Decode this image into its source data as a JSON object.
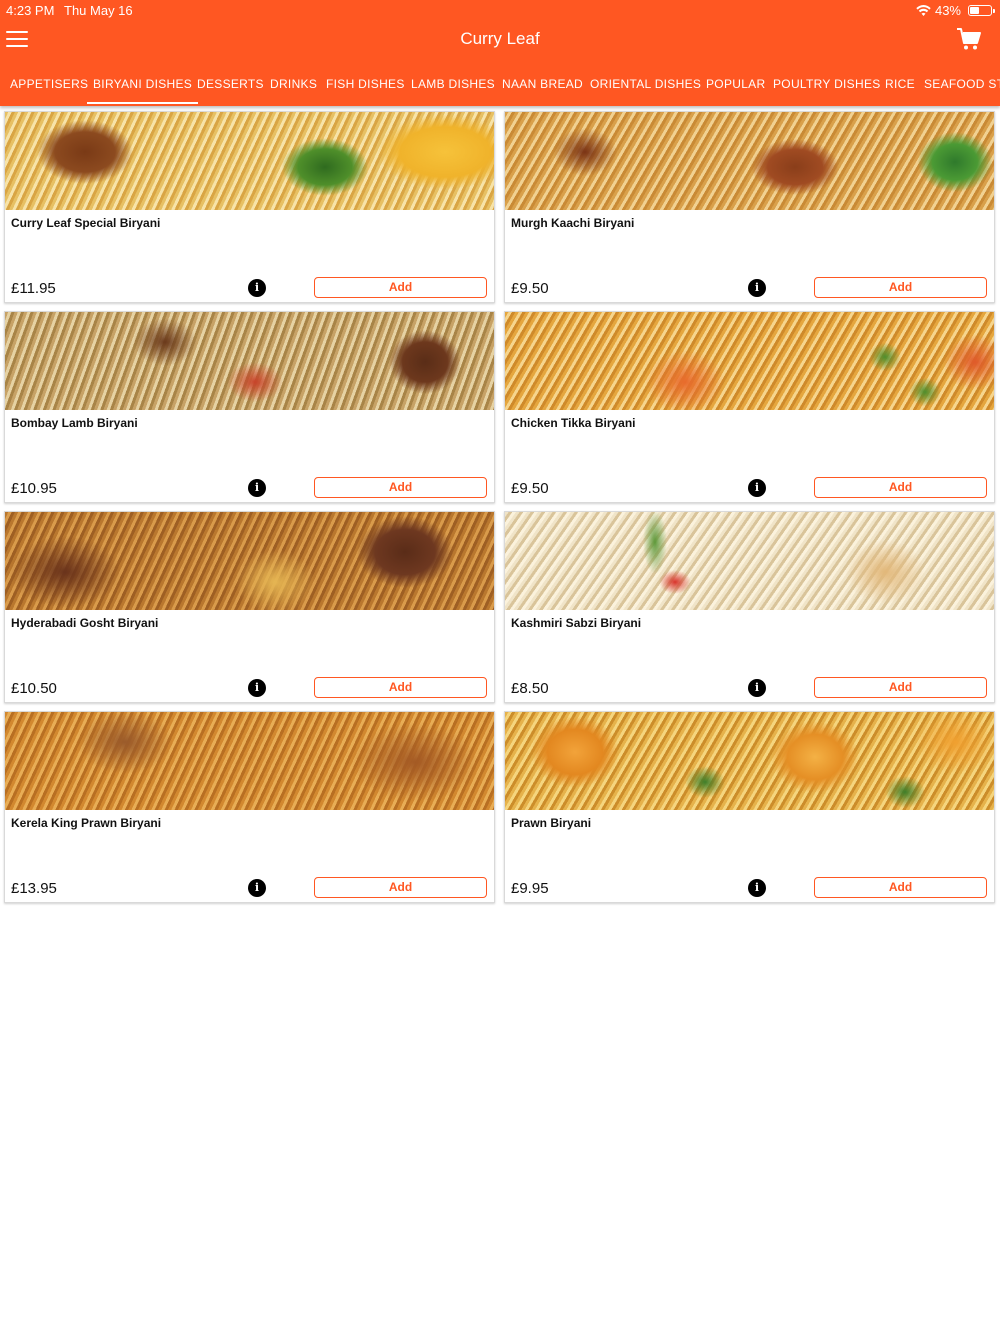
{
  "status_bar": {
    "time": "4:23 PM",
    "date": "Thu May 16",
    "battery_text": "43%",
    "battery_level": 0.43
  },
  "header": {
    "title": "Curry Leaf",
    "menu_icon": "hamburger-menu-icon",
    "cart_icon": "shopping-cart-icon",
    "background_color": "#ff5722"
  },
  "tabs": [
    {
      "label": "APPETISERS"
    },
    {
      "label": "BIRYANI DISHES",
      "active": true
    },
    {
      "label": "DESSERTS"
    },
    {
      "label": "DRINKS"
    },
    {
      "label": "FISH DISHES"
    },
    {
      "label": "LAMB DISHES"
    },
    {
      "label": "NAAN BREAD"
    },
    {
      "label": "ORIENTAL DISHES"
    },
    {
      "label": "POPULAR"
    },
    {
      "label": "POULTRY DISHES"
    },
    {
      "label": "RICE"
    },
    {
      "label": "SEAFOOD STARTERS"
    }
  ],
  "products": [
    {
      "name": "Curry Leaf Special Biryani",
      "price": "£11.95",
      "add_label": "Add"
    },
    {
      "name": "Murgh Kaachi Biryani",
      "price": "£9.50",
      "add_label": "Add"
    },
    {
      "name": "Bombay Lamb Biryani",
      "price": "£10.95",
      "add_label": "Add"
    },
    {
      "name": "Chicken Tikka Biryani",
      "price": "£9.50",
      "add_label": "Add"
    },
    {
      "name": "Hyderabadi Gosht Biryani",
      "price": "£10.50",
      "add_label": "Add"
    },
    {
      "name": "Kashmiri Sabzi Biryani",
      "price": "£8.50",
      "add_label": "Add"
    },
    {
      "name": "Kerela King Prawn Biryani",
      "price": "£13.95",
      "add_label": "Add"
    },
    {
      "name": "Prawn Biryani",
      "price": "£9.95",
      "add_label": "Add"
    }
  ],
  "info_icon": "info-icon",
  "accent_color": "#ff5722"
}
